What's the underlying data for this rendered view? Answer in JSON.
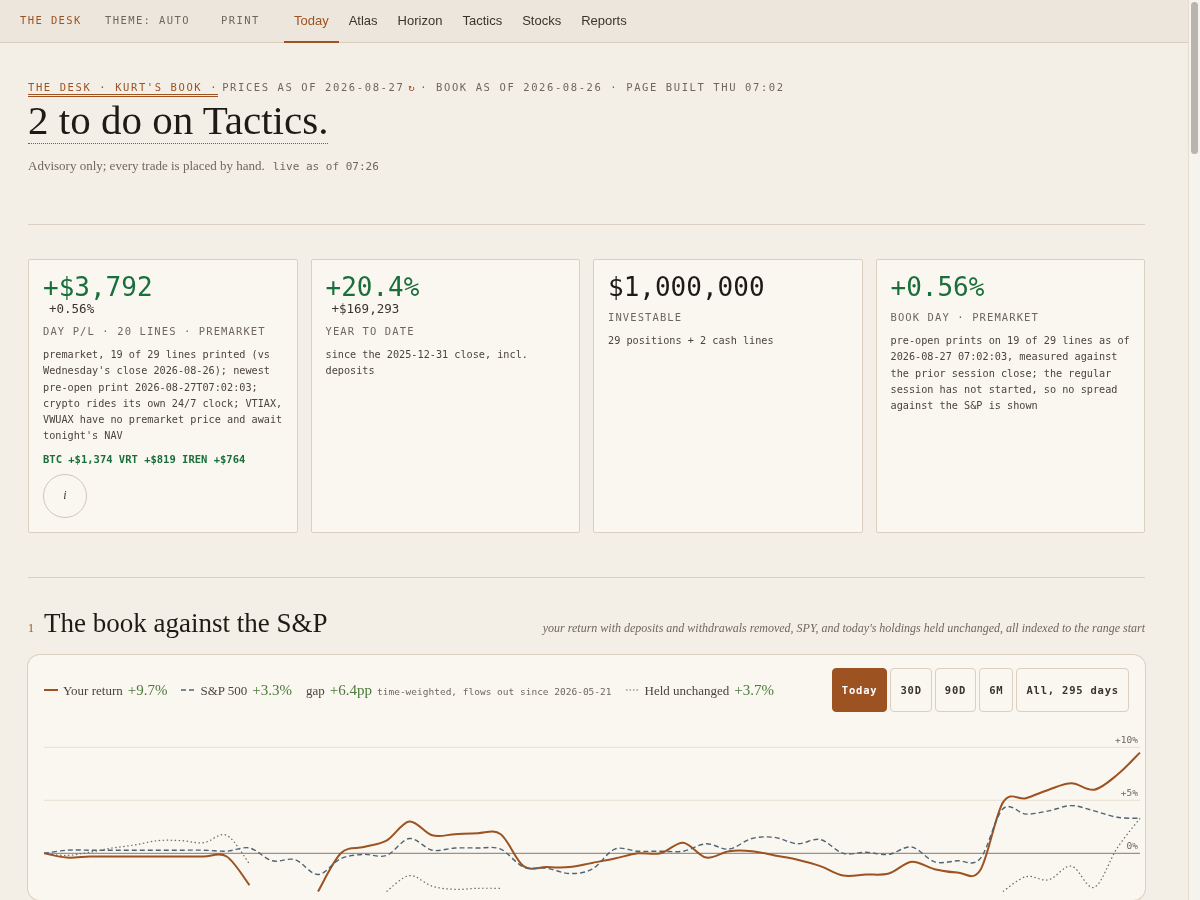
{
  "nav": {
    "brand": "THE DESK",
    "theme": "THEME: AUTO",
    "print": "PRINT",
    "tabs": [
      {
        "label": "Today",
        "selected": true
      },
      {
        "label": "Atlas",
        "selected": false
      },
      {
        "label": "Horizon",
        "selected": false
      },
      {
        "label": "Tactics",
        "selected": false
      },
      {
        "label": "Stocks",
        "selected": false
      },
      {
        "label": "Reports",
        "selected": false
      }
    ]
  },
  "header": {
    "eyebrow_link": "THE DESK · KURT'S BOOK ·",
    "eyebrow_prices": "PRICES AS OF 2026-08-27",
    "refresh": "↻",
    "eyebrow_rest": "· BOOK AS OF 2026-08-26 · PAGE BUILT THU 07:02",
    "title": "2 to do on Tactics.",
    "subtitle": "Advisory only; every trade is placed by hand.",
    "live": "live as of 07:26"
  },
  "cards": [
    {
      "color": "#1a6e3c",
      "value": "+$3,792",
      "sub": "+0.56%",
      "label": "DAY P/L · 20 LINES · PREMARKET",
      "note": "premarket, 19 of 29 lines printed (vs Wednesday's close 2026-08-26); newest pre-open print 2026-08-27T07:02:03; crypto rides its own 24/7 clock; VTIAX, VWUAX have no premarket price and await tonight's NAV",
      "movers": "BTC +$1,374 VRT +$819 IREN +$764",
      "info": "i"
    },
    {
      "color": "#1a6e3c",
      "value": "+20.4%",
      "sub": "+$169,293",
      "label": "YEAR TO DATE",
      "note": "since the 2025-12-31 close, incl. deposits"
    },
    {
      "color": "#1f1a15",
      "value": "$1,000,000",
      "label": "INVESTABLE",
      "note": "29 positions + 2 cash lines"
    },
    {
      "color": "#1a6e3c",
      "value": "+0.56%",
      "label": "BOOK DAY · PREMARKET",
      "note": "pre-open prints on 19 of 29 lines as of 2026-08-27 07:02:03, measured against the prior session close; the regular session has not started, so no spread against the S&P is shown"
    }
  ],
  "section": {
    "number": "1",
    "title": "The book against the S&P",
    "caption": "your return with deposits and withdrawals removed, SPY, and today's holdings held unchanged, all indexed to the range start"
  },
  "chart": {
    "legend": [
      {
        "kind": "series",
        "value": "+9.7%"
      },
      {
        "kind": "series",
        "value": "+3.3%"
      },
      {
        "kind": "gap",
        "label": "gap",
        "value": "+6.4pp",
        "note": "time-weighted, flows out since 2026-05-21"
      },
      {
        "kind": "series",
        "value": "+3.7%"
      }
    ],
    "ranges": [
      {
        "label": "Today",
        "selected": true
      },
      {
        "label": "30D",
        "selected": false
      },
      {
        "label": "90D",
        "selected": false
      },
      {
        "label": "6M",
        "selected": false
      },
      {
        "label": "All, 295 days",
        "selected": false
      }
    ],
    "chart_data": {
      "type": "line",
      "ylim": [
        -4.4,
        18.7
      ],
      "yticks": [
        {
          "value": 0,
          "label": "0%"
        },
        {
          "value": 5,
          "label": "+5%"
        },
        {
          "value": 10,
          "label": "+10%"
        }
      ],
      "series": [
        {
          "name": "Your return",
          "color": "#9c5221",
          "line_style": "solid",
          "values": [
            0,
            -0.4,
            -0.3,
            -0.3,
            -0.3,
            -0.3,
            -0.3,
            -0.3,
            -0.3,
            -3,
            null,
            null,
            -3.6,
            0,
            0.6,
            1.2,
            3.0,
            1.7,
            1.8,
            1.9,
            1.8,
            -1.2,
            -1.3,
            -1.3,
            -0.9,
            -0.5,
            0,
            0,
            1.0,
            -0.4,
            0.2,
            0.2,
            -0.2,
            -0.6,
            -1.2,
            -2.1,
            -2.0,
            -1.9,
            -0.8,
            -1.5,
            -1.8,
            -1.6,
            4.8,
            5.2,
            6.0,
            6.6,
            6.0,
            7.4,
            9.5
          ]
        },
        {
          "name": "S&P 500",
          "color": "#4f6475",
          "line_style": "dashed",
          "values": [
            0,
            0.3,
            0.3,
            0.3,
            0.3,
            0.3,
            0.3,
            0.3,
            0.2,
            0.5,
            -0.7,
            -0.6,
            -2.0,
            -0.5,
            -0.1,
            -0.2,
            1.4,
            0.3,
            0.5,
            0.5,
            0.4,
            -1.3,
            -1.4,
            -1.9,
            -1.5,
            0.4,
            0.2,
            0.2,
            0.2,
            0.9,
            0.4,
            1.4,
            1.5,
            0.9,
            1.3,
            0,
            0.1,
            -0.1,
            0.6,
            -0.8,
            -0.7,
            -0.5,
            4.2,
            3.7,
            4.0,
            4.5,
            4.0,
            3.4,
            3.3
          ]
        },
        {
          "name": "Held unchanged",
          "color": "#6e6a63",
          "line_style": "dotted",
          "values": [
            0,
            -0.2,
            0.1,
            0.5,
            0.8,
            1.2,
            1.2,
            1.0,
            1.7,
            -1,
            null,
            null,
            null,
            null,
            null,
            -3.6,
            -2.1,
            -3.1,
            -3.4,
            -3.3,
            -3.3,
            null,
            null,
            null,
            null,
            null,
            null,
            null,
            null,
            null,
            null,
            null,
            null,
            null,
            null,
            null,
            null,
            null,
            null,
            null,
            null,
            null,
            -3.6,
            -2.2,
            -2.5,
            -1.2,
            -3.2,
            0.5,
            3.3
          ]
        }
      ]
    }
  }
}
